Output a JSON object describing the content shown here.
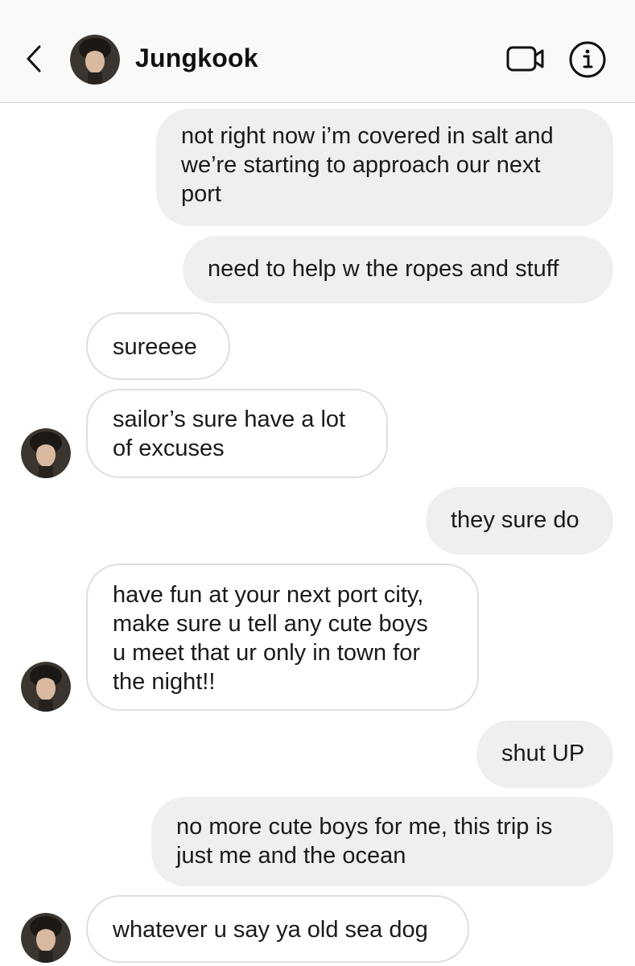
{
  "header": {
    "contact_name": "Jungkook",
    "back_icon": "chevron-left-icon",
    "video_icon": "video-camera-icon",
    "info_icon": "info-icon"
  },
  "colors": {
    "outgoing_bubble": "#efefef",
    "incoming_border": "#dedede",
    "header_bg": "#f9f9f9"
  },
  "messages": [
    {
      "direction": "outgoing",
      "text": "not right now i’m covered in salt and\nwe’re starting to approach our next\nport"
    },
    {
      "direction": "outgoing",
      "text": "need to help w the ropes and stuff"
    },
    {
      "direction": "incoming",
      "text": "sureeee"
    },
    {
      "direction": "incoming",
      "text": "sailor’s sure have a lot\nof excuses"
    },
    {
      "direction": "outgoing",
      "text": "they sure do"
    },
    {
      "direction": "incoming",
      "text": "have fun at your next port city,\nmake sure u tell any cute boys\nu meet that ur only in town for\nthe night!!"
    },
    {
      "direction": "outgoing",
      "text": "shut UP"
    },
    {
      "direction": "outgoing",
      "text": "no more cute boys for me, this trip is\njust me and the ocean"
    },
    {
      "direction": "incoming",
      "text": "whatever u say ya old sea dog"
    }
  ]
}
